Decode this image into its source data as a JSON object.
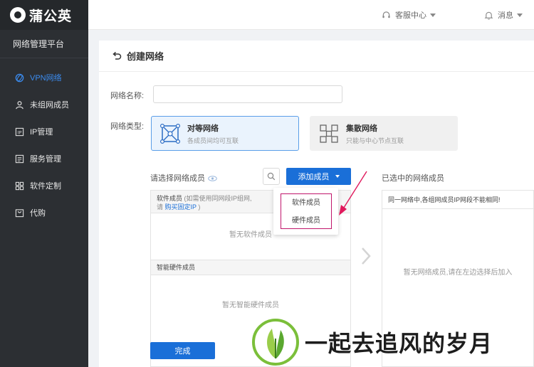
{
  "app": {
    "logo_text": "蒲公英",
    "platform_title": "网络管理平台"
  },
  "sidebar": {
    "items": [
      {
        "label": "VPN网络",
        "icon": "globe-icon",
        "active": true
      },
      {
        "label": "未组网成员",
        "icon": "user-icon",
        "active": false
      },
      {
        "label": "IP管理",
        "icon": "ip-icon",
        "active": false
      },
      {
        "label": "服务管理",
        "icon": "list-icon",
        "active": false
      },
      {
        "label": "软件定制",
        "icon": "grid-icon",
        "active": false
      },
      {
        "label": "代购",
        "icon": "bag-icon",
        "active": false
      }
    ]
  },
  "topbar": {
    "support_label": "客服中心",
    "messages_label": "消息"
  },
  "page": {
    "title": "创建网络",
    "name_label": "网络名称:",
    "name_value": "",
    "type_label": "网络类型:",
    "types": [
      {
        "title": "对等网络",
        "desc": "各成员间均可互联",
        "selected": true
      },
      {
        "title": "集散网络",
        "desc": "只能与中心节点互联",
        "selected": false
      }
    ],
    "select_members_label": "请选择网络成员",
    "add_member_button": "添加成员",
    "selected_members_label": "已选中的网络成员",
    "software_members_head": "软件成员",
    "software_members_hint": "(如需使用同网段IP组网,",
    "software_members_hint2": "请",
    "software_members_link": "购买固定IP",
    "software_members_hint3": ")",
    "software_empty": "暂无软件成员",
    "hardware_members_head": "智能硬件成员",
    "hardware_empty": "暂无智能硬件成员",
    "right_notice": "同一网络中,各组网成员IP网段不能相同!",
    "right_empty": "暂无网络成员,请在左边选择后加入",
    "done_button": "完成"
  },
  "dropdown": {
    "items": [
      "软件成员",
      "硬件成员"
    ]
  },
  "watermark": {
    "text": "一起去追风的岁月"
  },
  "colors": {
    "accent": "#1a6fd8",
    "sidebar_bg": "#2c2f33",
    "active_nav": "#3b8cf0",
    "highlight_box": "#c0166b",
    "annotation_arrow": "#e0195c"
  }
}
